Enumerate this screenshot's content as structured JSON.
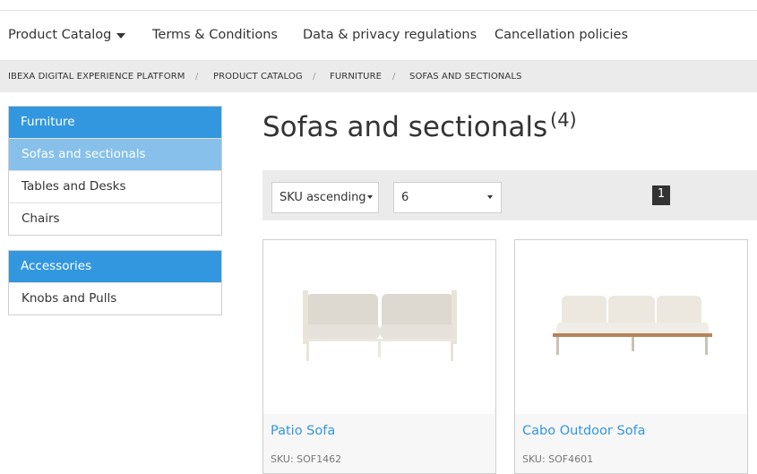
{
  "nav": {
    "items": [
      "Product Catalog",
      "Terms & Conditions",
      "Data & privacy regulations",
      "Cancellation policies"
    ]
  },
  "breadcrumb": {
    "items": [
      "IBEXA DIGITAL EXPERIENCE PLATFORM",
      "PRODUCT CATALOG",
      "FURNITURE",
      "SOFAS AND SECTIONALS"
    ],
    "separator": "/"
  },
  "sidebar": {
    "groups": [
      {
        "title": "Furniture",
        "items": [
          "Sofas and sectionals",
          "Tables and Desks",
          "Chairs"
        ]
      },
      {
        "title": "Accessories",
        "items": [
          "Knobs and Pulls"
        ]
      }
    ]
  },
  "main": {
    "title": "Sofas and sectionals",
    "count": "(4)"
  },
  "toolbar": {
    "sort_value": "SKU ascending",
    "per_page_value": "6",
    "page": "1"
  },
  "products": [
    {
      "name": "Patio Sofa",
      "sku": "SKU: SOF1462"
    },
    {
      "name": "Cabo Outdoor Sofa",
      "sku": "SKU: SOF4601"
    }
  ],
  "colors": {
    "accent": "#3397e0",
    "active_item": "#86c0eb"
  }
}
